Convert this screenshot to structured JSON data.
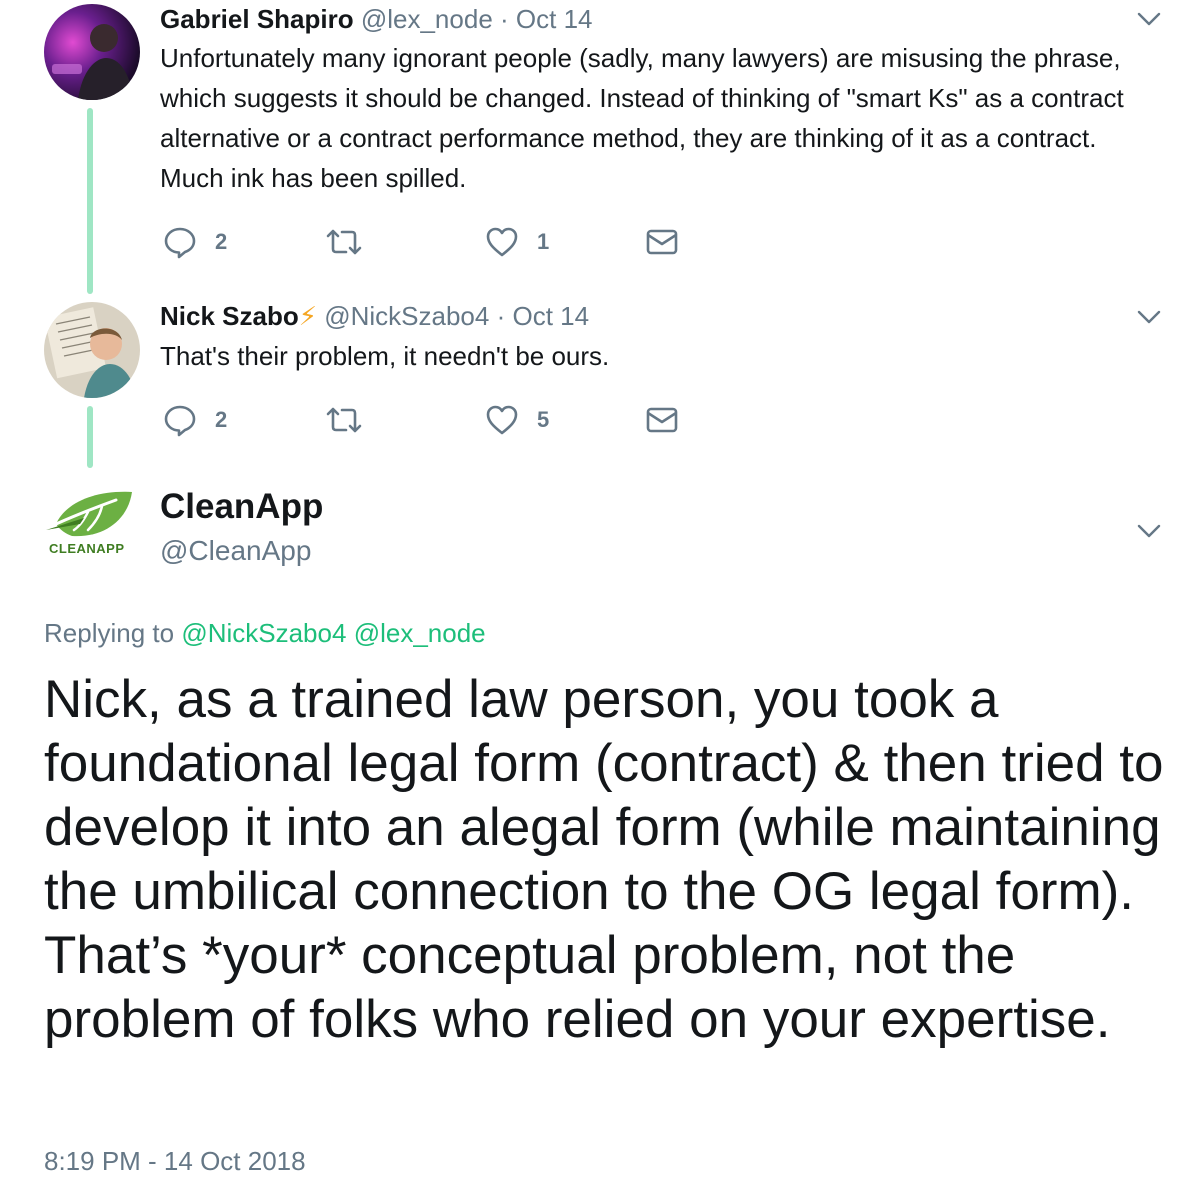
{
  "thread": [
    {
      "name": "Gabriel Shapiro",
      "handle": "@lex_node",
      "sep": "·",
      "date": "Oct 14",
      "text": "Unfortunately many ignorant people (sadly, many lawyers) are misusing the phrase, which suggests it should be changed. Instead of thinking of \"smart Ks\" as a contract alternative or a contract performance method, they are thinking of it as a contract. Much ink has been spilled.",
      "replies": "2",
      "retweets": "",
      "likes": "1"
    },
    {
      "name": "Nick Szabo",
      "badge": "⚡",
      "handle": "@NickSzabo4",
      "sep": "·",
      "date": "Oct 14",
      "text": "That's their problem, it needn't be ours.",
      "replies": "2",
      "retweets": "",
      "likes": "5"
    }
  ],
  "main": {
    "name": "CleanApp",
    "handle": "@CleanApp",
    "logo_text": "CLEANAPP",
    "replying_label": "Replying to",
    "replying_to": [
      "@NickSzabo4",
      "@lex_node"
    ],
    "text": "Nick, as a trained law person, you took a foundational legal form (contract) & then tried to develop it into an alegal form (while maintaining the umbilical connection to the OG legal form). That’s *your* conceptual problem, not the problem of folks who relied on your expertise.",
    "timestamp": "8:19 PM - 14 Oct 2018"
  },
  "colors": {
    "thread_line": "#9fe6c4",
    "link": "#1dbe7a",
    "muted": "#657786",
    "text": "#14171a",
    "bolt": "#f5a623"
  },
  "icons": [
    "reply-icon",
    "retweet-icon",
    "like-icon",
    "message-icon",
    "chevron-down-icon",
    "lightning-icon"
  ]
}
